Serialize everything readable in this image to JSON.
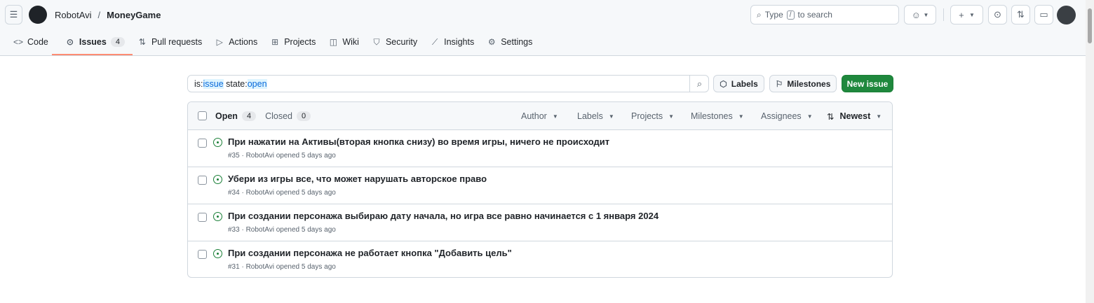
{
  "header": {
    "owner": "RobotAvi",
    "separator": "/",
    "repo": "MoneyGame",
    "search_placeholder_pre": "Type",
    "search_key": "/",
    "search_placeholder_post": "to search"
  },
  "nav": [
    {
      "label": "Code"
    },
    {
      "label": "Issues",
      "count": "4"
    },
    {
      "label": "Pull requests"
    },
    {
      "label": "Actions"
    },
    {
      "label": "Projects"
    },
    {
      "label": "Wiki"
    },
    {
      "label": "Security"
    },
    {
      "label": "Insights"
    },
    {
      "label": "Settings"
    }
  ],
  "query": {
    "p1": "is:",
    "p2": "issue",
    "p3": " state:",
    "p4": "open"
  },
  "buttons": {
    "labels": "Labels",
    "milestones": "Milestones",
    "new_issue": "New issue"
  },
  "list": {
    "open": "Open",
    "open_count": "4",
    "closed": "Closed",
    "closed_count": "0",
    "filters": [
      "Author",
      "Labels",
      "Projects",
      "Milestones",
      "Assignees"
    ],
    "sort": "Newest"
  },
  "issues": [
    {
      "title": "При нажатии на Активы(вторая кнопка снизу) во время игры, ничего не происходит",
      "meta": "#35 · RobotAvi opened 5 days ago"
    },
    {
      "title": "Убери из игры все, что может нарушать авторское право",
      "meta": "#34 · RobotAvi opened 5 days ago"
    },
    {
      "title": "При создании персонажа выбираю дату начала, но игра все равно начинается с 1 января 2024",
      "meta": "#33 · RobotAvi opened 5 days ago"
    },
    {
      "title": "При создании персонажа не работает кнопка \"Добавить цель\"",
      "meta": "#31 · RobotAvi opened 5 days ago"
    }
  ],
  "colors": {
    "accent": "#1f883d",
    "underline": "#fd8c73",
    "open": "#1a7f37"
  }
}
